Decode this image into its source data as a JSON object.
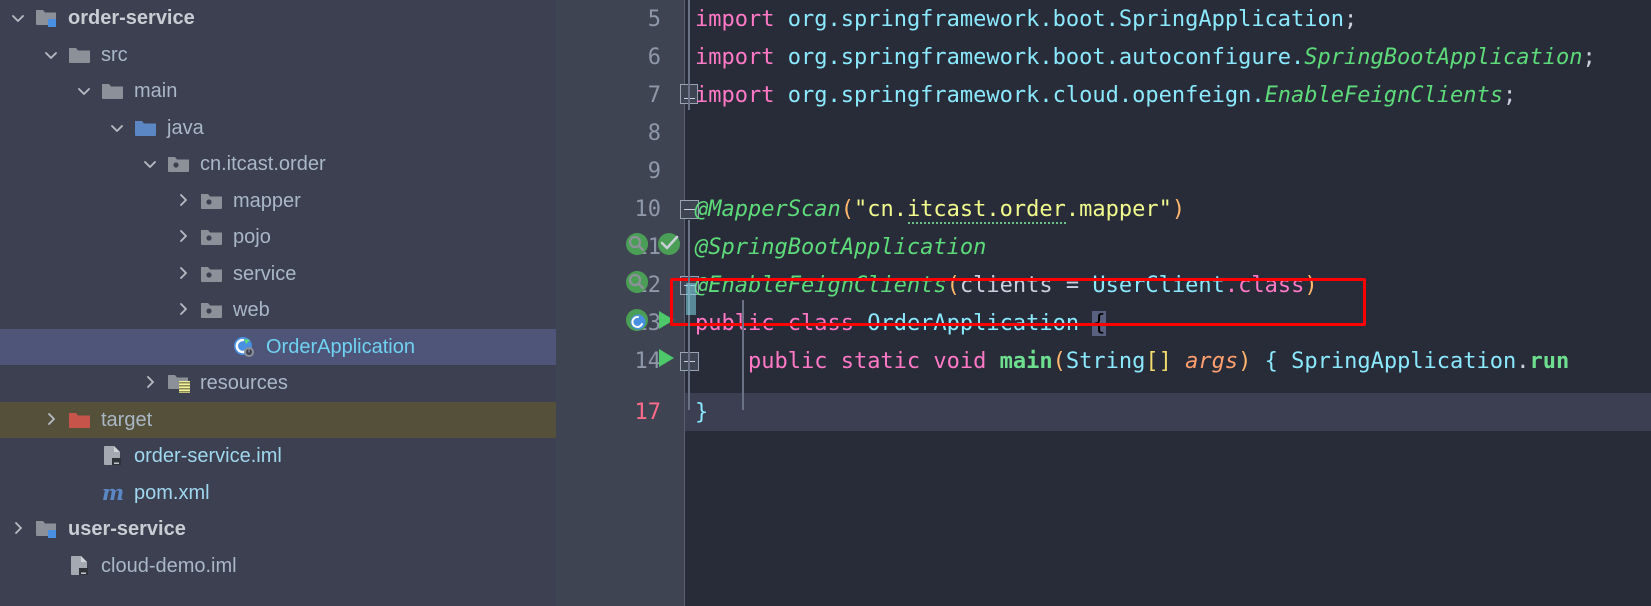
{
  "project_tree": {
    "name": "project-tool-window",
    "items": [
      {
        "label": "order-service",
        "indent": 0,
        "arrow": "down",
        "icon": "module-folder-icon",
        "style": "bold",
        "state": "normal"
      },
      {
        "label": "src",
        "indent": 1,
        "arrow": "down",
        "icon": "folder-icon",
        "style": "normal",
        "state": "normal"
      },
      {
        "label": "main",
        "indent": 2,
        "arrow": "down",
        "icon": "folder-icon",
        "style": "normal",
        "state": "normal"
      },
      {
        "label": "java",
        "indent": 3,
        "arrow": "down",
        "icon": "source-folder-icon",
        "style": "normal",
        "state": "normal"
      },
      {
        "label": "cn.itcast.order",
        "indent": 4,
        "arrow": "down",
        "icon": "package-icon",
        "style": "normal",
        "state": "normal"
      },
      {
        "label": "mapper",
        "indent": 5,
        "arrow": "right",
        "icon": "package-icon",
        "style": "normal",
        "state": "normal"
      },
      {
        "label": "pojo",
        "indent": 5,
        "arrow": "right",
        "icon": "package-icon",
        "style": "normal",
        "state": "normal"
      },
      {
        "label": "service",
        "indent": 5,
        "arrow": "right",
        "icon": "package-icon",
        "style": "normal",
        "state": "normal"
      },
      {
        "label": "web",
        "indent": 5,
        "arrow": "right",
        "icon": "package-icon",
        "style": "normal",
        "state": "normal"
      },
      {
        "label": "OrderApplication",
        "indent": 6,
        "arrow": "none",
        "icon": "spring-class-icon",
        "style": "cyan",
        "state": "selected"
      },
      {
        "label": "resources",
        "indent": 4,
        "arrow": "right",
        "icon": "resources-folder-icon",
        "style": "normal",
        "state": "normal"
      },
      {
        "label": "target",
        "indent": 1,
        "arrow": "right",
        "icon": "excluded-folder-icon",
        "style": "normal",
        "state": "excluded"
      },
      {
        "label": "order-service.iml",
        "indent": 2,
        "arrow": "none",
        "icon": "iml-file-icon",
        "style": "cyanlite",
        "state": "normal"
      },
      {
        "label": "pom.xml",
        "indent": 2,
        "arrow": "none",
        "icon": "maven-icon",
        "style": "cyanlite",
        "state": "normal"
      },
      {
        "label": "user-service",
        "indent": 0,
        "arrow": "right",
        "icon": "module-folder-icon",
        "style": "bold",
        "state": "normal"
      },
      {
        "label": "cloud-demo.iml",
        "indent": 1,
        "arrow": "none",
        "icon": "iml-file-icon",
        "style": "normal",
        "state": "normal"
      }
    ]
  },
  "editor": {
    "name": "code-editor",
    "lines": [
      {
        "num": "5",
        "text": "import org.springframework.boot.SpringApplication;",
        "fold": "none",
        "gutter": []
      },
      {
        "num": "6",
        "text": "import org.springframework.boot.autoconfigure.SpringBootApplication;",
        "fold": "none",
        "gutter": []
      },
      {
        "num": "7",
        "text": "import org.springframework.cloud.openfeign.EnableFeignClients;",
        "fold": "collapse-imports",
        "gutter": []
      },
      {
        "num": "8",
        "text": "",
        "fold": "none",
        "gutter": []
      },
      {
        "num": "9",
        "text": "",
        "fold": "none",
        "gutter": []
      },
      {
        "num": "10",
        "text": "@MapperScan(\"cn.itcast.order.mapper\")",
        "fold": "minus",
        "gutter": []
      },
      {
        "num": "11",
        "text": "@SpringBootApplication",
        "fold": "none",
        "gutter": [
          "bean-search-icon",
          "bean-check-icon"
        ]
      },
      {
        "num": "12",
        "text": "@EnableFeignClients(clients = UserClient.class)",
        "fold": "minus",
        "gutter": [
          "bean-search-icon"
        ]
      },
      {
        "num": "13",
        "text": "public class OrderApplication {",
        "fold": "none",
        "gutter": [
          "spring-bean-icon",
          "run-icon"
        ]
      },
      {
        "num": "14",
        "text": "    public static void main(String[] args) { SpringApplication.run",
        "fold": "plus",
        "gutter": [
          "run-icon"
        ]
      },
      {
        "num": "17",
        "text": "}",
        "fold": "none",
        "gutter": []
      }
    ],
    "string_literal": "\"cn.itcast.order.mapper\"",
    "highlight_box": {
      "target_line": "12",
      "color": "#ff0000"
    }
  },
  "colors": {
    "tree_background": "#3c4050",
    "selection": "#4e5578",
    "excluded_row": "#55503a",
    "editor_background": "#282b38",
    "gutter_background": "#3f4452",
    "keyword": "#ff79c6",
    "type": "#8be9fd",
    "annotation": "#5ddb7a",
    "string": "#f1fa8c",
    "parameter": "#ff9f6e",
    "highlight_border": "#ff0000"
  }
}
